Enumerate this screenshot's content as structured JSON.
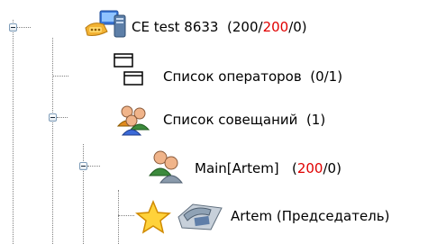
{
  "tree": {
    "root": {
      "label": "CE test 8633",
      "count_open": "(",
      "count_a": "200/",
      "count_b": "200",
      "count_c": "/0)",
      "icon": "conference-server-icon",
      "expanded": true
    },
    "operators": {
      "label": "Список операторов",
      "count": "(0/1)",
      "icon": "operator-windows-icon"
    },
    "meetings": {
      "label": "Список совещаний",
      "count": "(1)",
      "icon": "users-group-icon",
      "expanded": true
    },
    "meeting": {
      "label": "Main[Artem]",
      "count_open": "(",
      "count_a": "200",
      "count_b": "/0)",
      "icon": "two-users-icon",
      "expanded": true
    },
    "participant": {
      "label": "Artem (Председатель)",
      "icons": [
        "star-icon",
        "phone-icon"
      ]
    }
  },
  "colors": {
    "highlight": "#e00000",
    "tree_line": "#808080"
  }
}
